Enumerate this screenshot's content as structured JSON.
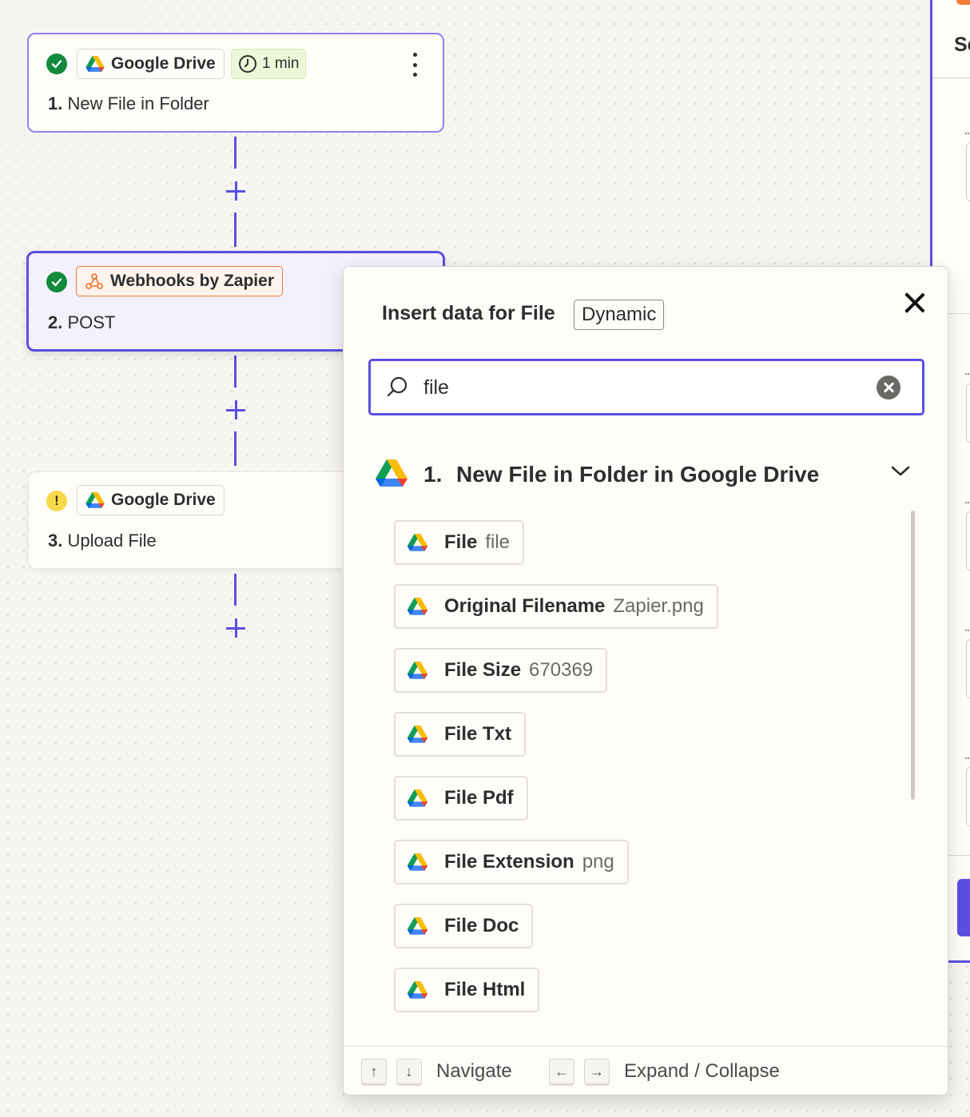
{
  "canvas": {
    "steps": [
      {
        "app": "Google Drive",
        "number": "1.",
        "title": "New File in Folder",
        "status": "success",
        "badge": "1 min"
      },
      {
        "app": "Webhooks by Zapier",
        "number": "2.",
        "title": "POST",
        "status": "success"
      },
      {
        "app": "Google Drive",
        "number": "3.",
        "title": "Upload File",
        "status": "warning",
        "status_glyph": "!"
      }
    ]
  },
  "side_panel": {
    "title_partial": "Se"
  },
  "popup": {
    "title": "Insert data for File",
    "badge": "Dynamic",
    "search": {
      "value": "file"
    },
    "group": {
      "number": "1.",
      "title": "New File in Folder in Google Drive",
      "items": [
        {
          "label": "File",
          "value": "file"
        },
        {
          "label": "Original Filename",
          "value": "Zapier.png"
        },
        {
          "label": "File Size",
          "value": "670369"
        },
        {
          "label": "File Txt",
          "value": ""
        },
        {
          "label": "File Pdf",
          "value": ""
        },
        {
          "label": "File Extension",
          "value": "png"
        },
        {
          "label": "File Doc",
          "value": ""
        },
        {
          "label": "File Html",
          "value": ""
        }
      ]
    },
    "footer": {
      "navigate_keys": [
        "↑",
        "↓"
      ],
      "navigate_label": "Navigate",
      "expand_keys": [
        "←",
        "→"
      ],
      "expand_label": "Expand / Collapse"
    }
  },
  "colors": {
    "accent": "#5b4fe0",
    "success": "#138a3c",
    "warning": "#f5d94a",
    "webhook": "#f27b35"
  },
  "icons": [
    "google-drive-icon",
    "webhook-icon",
    "clock-icon",
    "check-icon",
    "search-icon",
    "close-icon",
    "clear-icon",
    "chevron-down-icon",
    "kebab-menu-icon",
    "plus-icon"
  ]
}
